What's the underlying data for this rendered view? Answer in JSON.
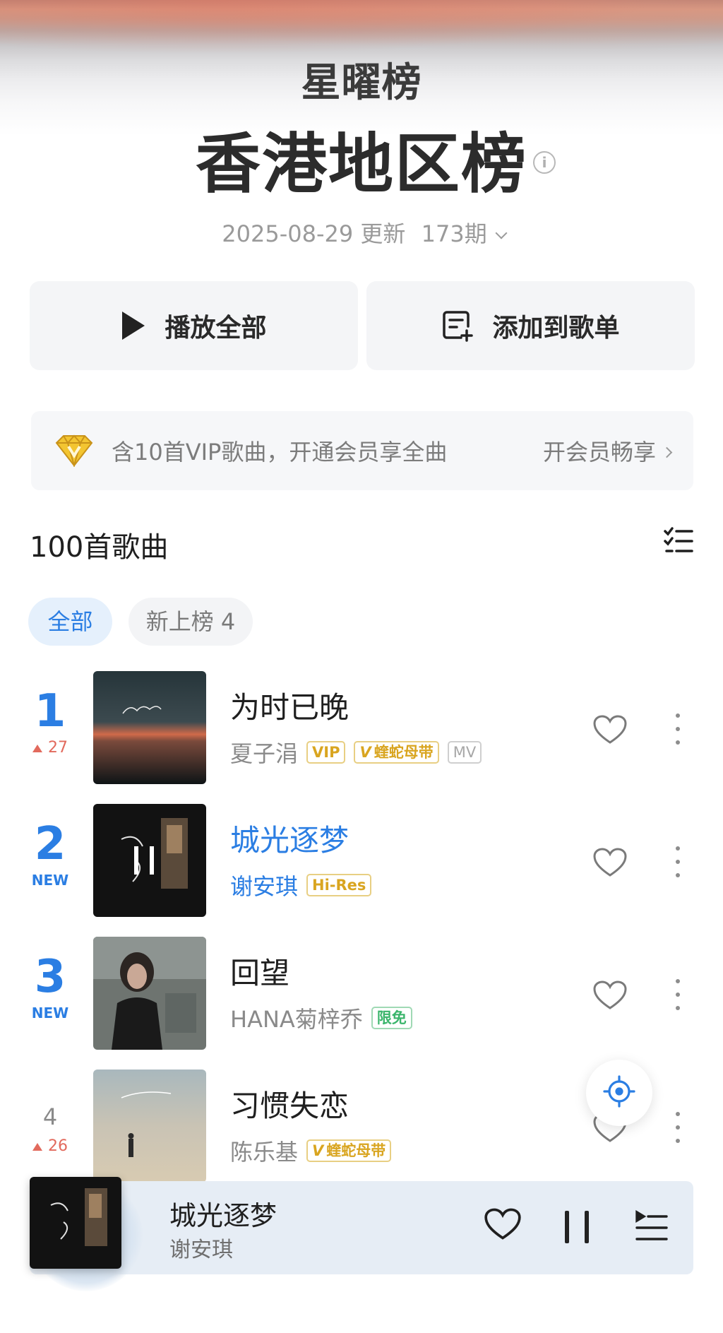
{
  "header": {
    "brand": "星曜榜",
    "title": "香港地区榜",
    "update_date": "2025-08-29 更新",
    "issue": "173期"
  },
  "actions": {
    "play_all": "播放全部",
    "add_to_playlist": "添加到歌单"
  },
  "vip_banner": {
    "text": "含10首VIP歌曲，开通会员享全曲",
    "cta": "开会员畅享"
  },
  "list": {
    "count_label": "100首歌曲",
    "filters": [
      {
        "label": "全部",
        "active": true
      },
      {
        "label": "新上榜 4",
        "active": false
      }
    ]
  },
  "songs": [
    {
      "rank": "1",
      "change": "27",
      "change_type": "up",
      "title": "为时已晚",
      "artist": "夏子涓",
      "tags": [
        "VIP",
        "蝰蛇母带",
        "MV"
      ],
      "playing": false
    },
    {
      "rank": "2",
      "change": "NEW",
      "change_type": "new",
      "title": "城光逐梦",
      "artist": "谢安琪",
      "tags": [
        "Hi-Res"
      ],
      "playing": true
    },
    {
      "rank": "3",
      "change": "NEW",
      "change_type": "new",
      "title": "回望",
      "artist": "HANA菊梓乔",
      "tags": [
        "限免"
      ],
      "playing": false
    },
    {
      "rank": "4",
      "change": "26",
      "change_type": "up",
      "title": "习惯失恋",
      "artist": "陈乐基",
      "tags": [
        "蝰蛇母带"
      ],
      "playing": false
    }
  ],
  "now_playing": {
    "title": "城光逐梦",
    "artist": "谢安琪",
    "state": "playing"
  },
  "colors": {
    "accent": "#2b7ee3",
    "rank_up": "#e26a5d",
    "vip_gold": "#d9a520",
    "free_green": "#3bb56c"
  },
  "icons": [
    "info-icon",
    "play-icon",
    "add-to-playlist-icon",
    "vip-diamond-icon",
    "list-options-icon",
    "heart-icon",
    "more-icon",
    "locate-icon",
    "pause-icon",
    "queue-icon"
  ]
}
